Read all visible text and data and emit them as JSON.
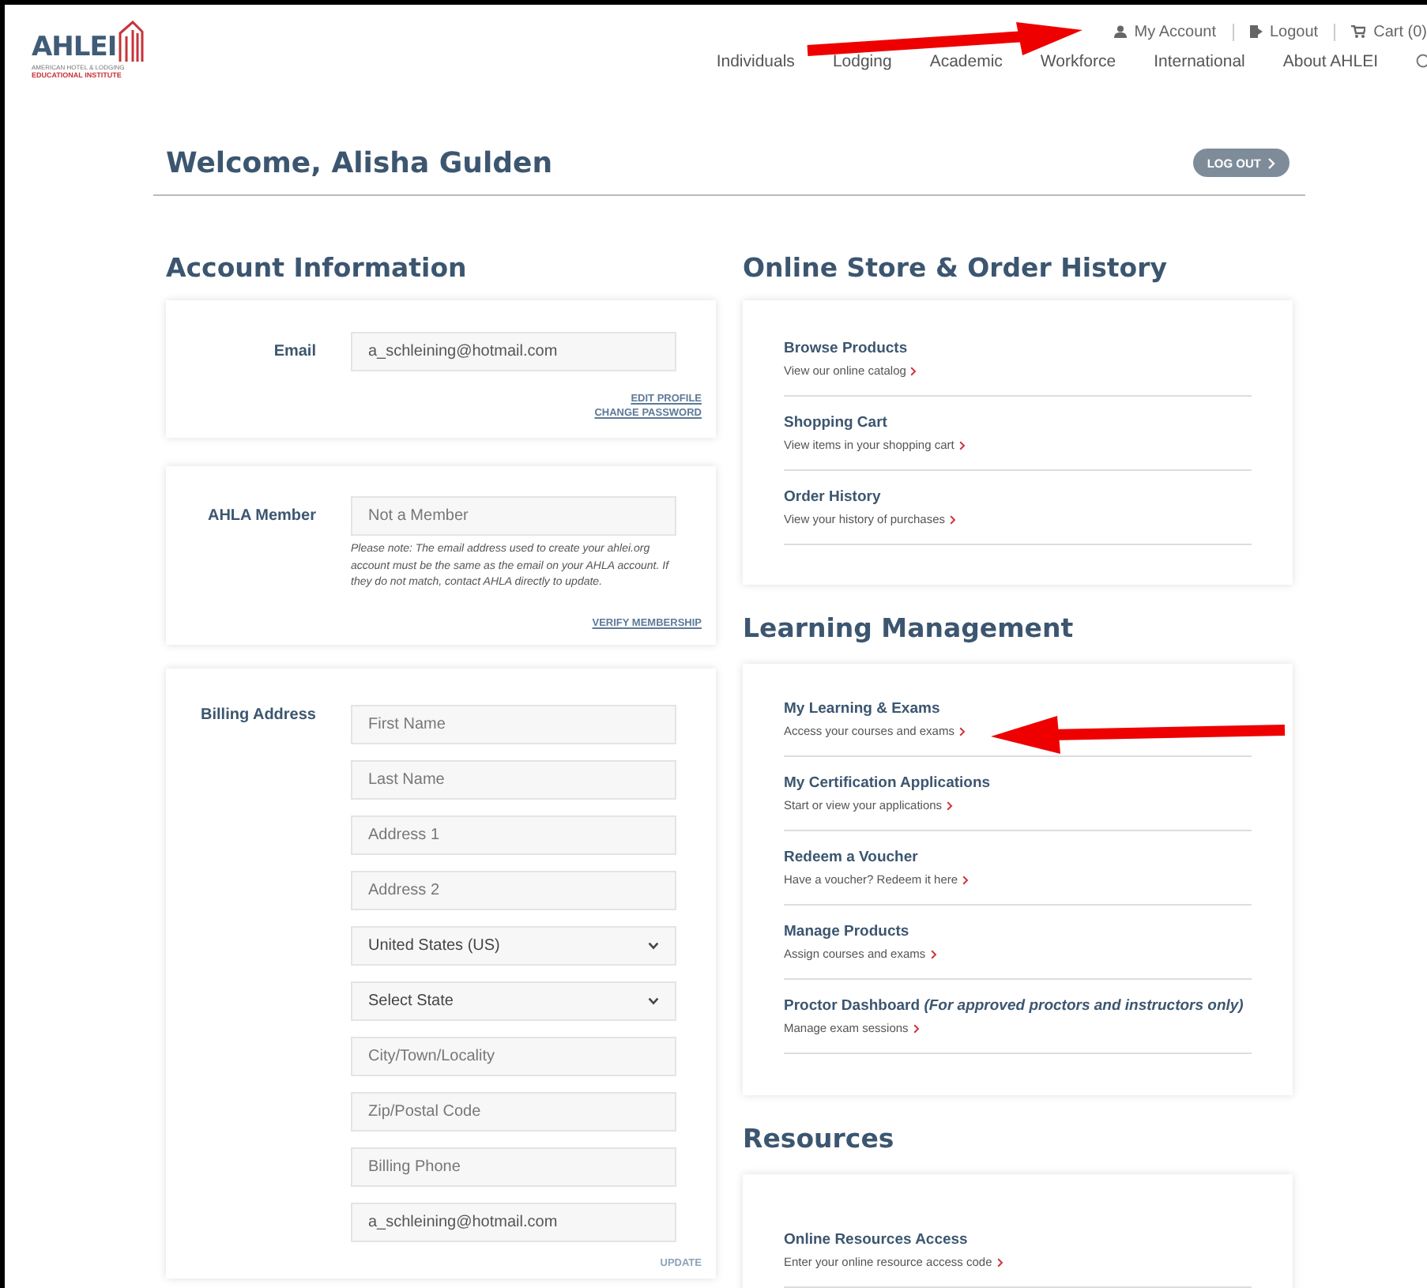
{
  "logo": {
    "name": "AHLEI",
    "line1": "AMERICAN HOTEL & LODGING",
    "line2": "EDUCATIONAL INSTITUTE"
  },
  "top_links": [
    {
      "kind": "account",
      "label": "My Account"
    },
    {
      "kind": "logout",
      "label": "Logout"
    },
    {
      "kind": "cart",
      "label": "Cart (0)"
    }
  ],
  "nav": [
    "Individuals",
    "Lodging",
    "Academic",
    "Workforce",
    "International",
    "About AHLEI"
  ],
  "welcome": {
    "title": "Welcome, Alisha Gulden",
    "button": "LOG OUT"
  },
  "account": {
    "heading": "Account Information",
    "email": {
      "label": "Email",
      "value": "a_schleining@hotmail.com",
      "links": [
        "EDIT PROFILE",
        "CHANGE PASSWORD"
      ]
    },
    "member": {
      "label": "AHLA Member",
      "placeholder": "Not a Member",
      "note": "Please note: The email address used to create your ahlei.org account must be the same as the email on your AHLA account. If they do not match, contact AHLA directly to update.",
      "link": "VERIFY MEMBERSHIP"
    },
    "billing": {
      "label": "Billing Address",
      "fields": [
        {
          "kind": "input",
          "placeholder": "First Name"
        },
        {
          "kind": "input",
          "placeholder": "Last Name"
        },
        {
          "kind": "input",
          "placeholder": "Address 1"
        },
        {
          "kind": "input",
          "placeholder": "Address 2"
        },
        {
          "kind": "select",
          "value": "United States (US)"
        },
        {
          "kind": "select",
          "value": "Select State"
        },
        {
          "kind": "input",
          "placeholder": "City/Town/Locality"
        },
        {
          "kind": "input",
          "placeholder": "Zip/Postal Code"
        },
        {
          "kind": "input",
          "placeholder": "Billing Phone"
        },
        {
          "kind": "input",
          "value": "a_schleining@hotmail.com"
        }
      ],
      "link": "UPDATE"
    }
  },
  "sections": [
    {
      "heading": "Online Store & Order History",
      "items": [
        {
          "title": "Browse Products",
          "description": "View our online catalog"
        },
        {
          "title": "Shopping Cart",
          "description": "View items in your shopping cart"
        },
        {
          "title": "Order History",
          "description": "View your history of purchases"
        }
      ]
    },
    {
      "heading": "Learning Management",
      "items": [
        {
          "title": "My Learning & Exams",
          "description": "Access your courses and exams"
        },
        {
          "title": "My Certification Applications",
          "description": "Start or view your applications"
        },
        {
          "title": "Redeem a Voucher",
          "description": "Have a voucher? Redeem it here"
        },
        {
          "title": "Manage Products",
          "description": "Assign courses and exams"
        },
        {
          "title": "Proctor Dashboard *(For approved proctors and instructors only)*",
          "description": "Manage exam sessions"
        }
      ]
    },
    {
      "heading": "Resources",
      "items": [
        {
          "title": "Online Resources Access",
          "description": "Enter your online resource access code"
        }
      ]
    }
  ]
}
